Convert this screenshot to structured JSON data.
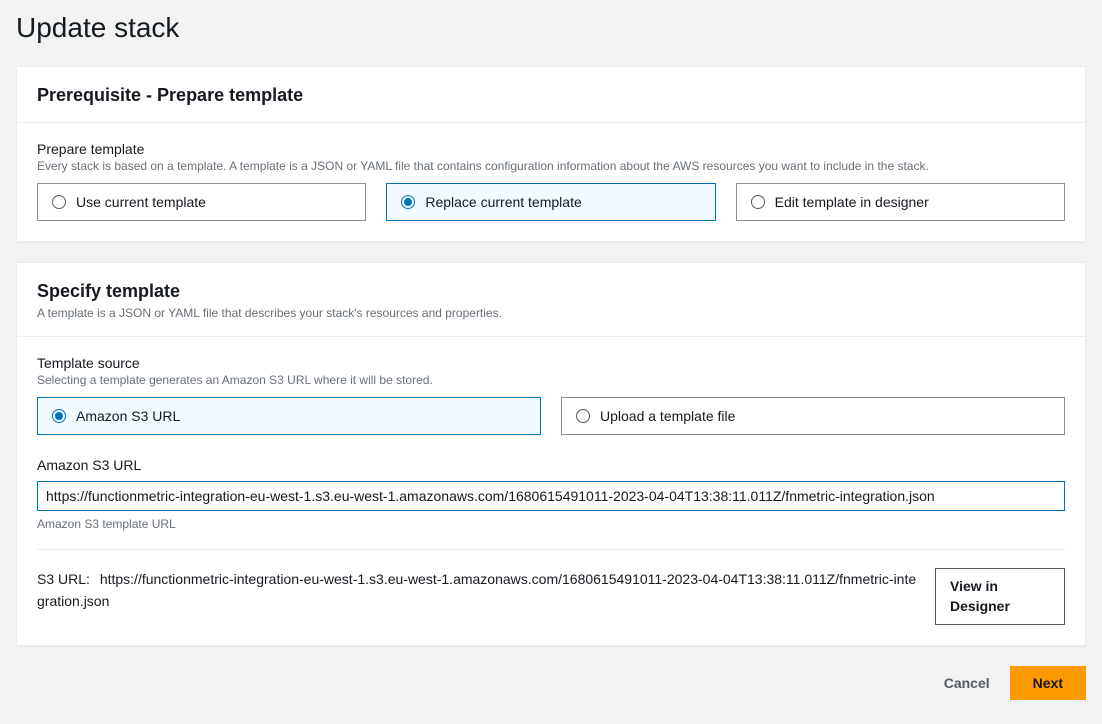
{
  "page": {
    "title": "Update stack"
  },
  "panel1": {
    "heading": "Prerequisite - Prepare template",
    "field_label": "Prepare template",
    "field_desc": "Every stack is based on a template. A template is a JSON or YAML file that contains configuration information about the AWS resources you want to include in the stack.",
    "options": [
      {
        "label": "Use current template",
        "selected": false
      },
      {
        "label": "Replace current template",
        "selected": true
      },
      {
        "label": "Edit template in designer",
        "selected": false
      }
    ]
  },
  "panel2": {
    "heading": "Specify template",
    "heading_desc": "A template is a JSON or YAML file that describes your stack's resources and properties.",
    "source_label": "Template source",
    "source_desc": "Selecting a template generates an Amazon S3 URL where it will be stored.",
    "source_options": [
      {
        "label": "Amazon S3 URL",
        "selected": true
      },
      {
        "label": "Upload a template file",
        "selected": false
      }
    ],
    "url_label": "Amazon S3 URL",
    "url_value": "https://functionmetric-integration-eu-west-1.s3.eu-west-1.amazonaws.com/1680615491011-2023-04-04T13:38:11.011Z/fnmetric-integration.json",
    "url_help": "Amazon S3 template URL",
    "s3_prefix": "S3 URL:",
    "s3_display": "https://functionmetric-integration-eu-west-1.s3.eu-west-1.amazonaws.com/1680615491011-2023-04-04T13:38:11.011Z/fnmetric-integration.json",
    "view_designer": "View in Designer"
  },
  "footer": {
    "cancel": "Cancel",
    "next": "Next"
  }
}
